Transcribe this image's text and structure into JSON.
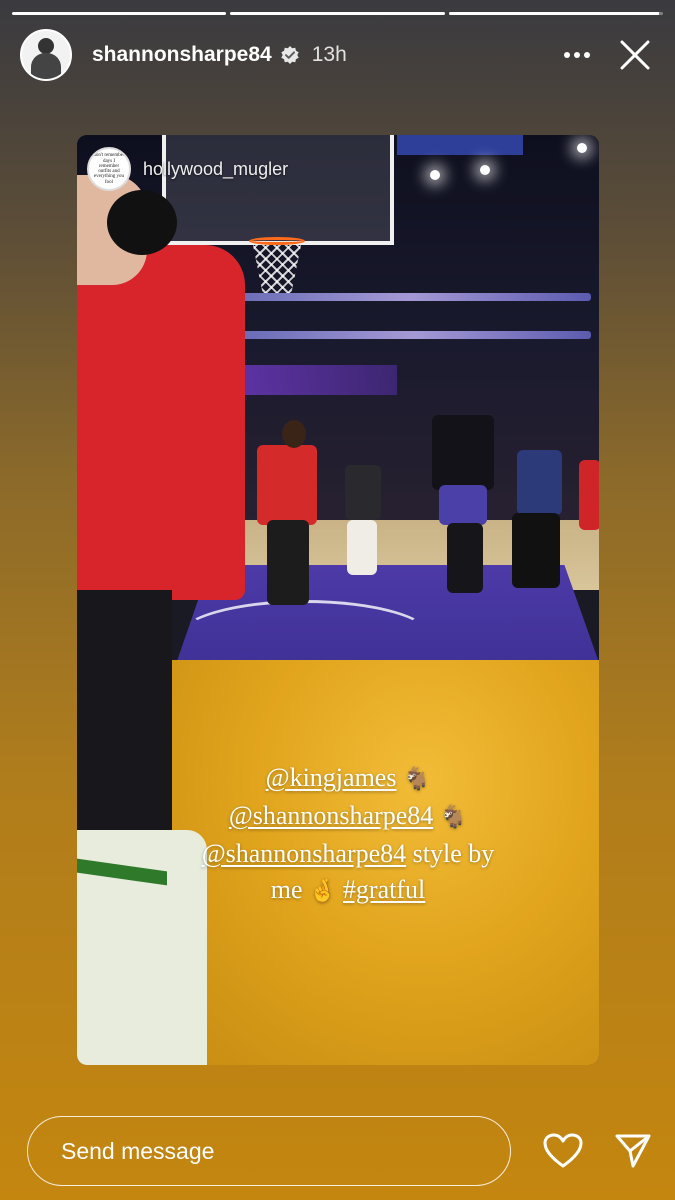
{
  "story": {
    "progress": [
      1.0,
      1.0,
      0.98
    ],
    "username": "shannonsharpe84",
    "verified_icon": "verified-badge-icon",
    "time": "13h",
    "more_icon": "more-horizontal-icon",
    "close_icon": "close-icon"
  },
  "embedded_post": {
    "username": "hollywood_mugler",
    "avatar_text": "don't remember days I remember outfits and everything you fool",
    "caption": {
      "line1_mention": "@kingjames",
      "line2_mention": "@shannonsharpe84",
      "line3_mention": "@shannonsharpe84",
      "line3_text": " style by",
      "line4_text": "me",
      "line4_hashtag": "#gratful",
      "goat_emoji": "🐐",
      "hands_emoji": "🤞"
    }
  },
  "footer": {
    "message_placeholder": "Send message",
    "heart_icon": "heart-icon",
    "send_icon": "send-icon"
  },
  "colors": {
    "background_top": "#3a3a3f",
    "background_bottom": "#c4860f",
    "text": "#ffffff"
  }
}
